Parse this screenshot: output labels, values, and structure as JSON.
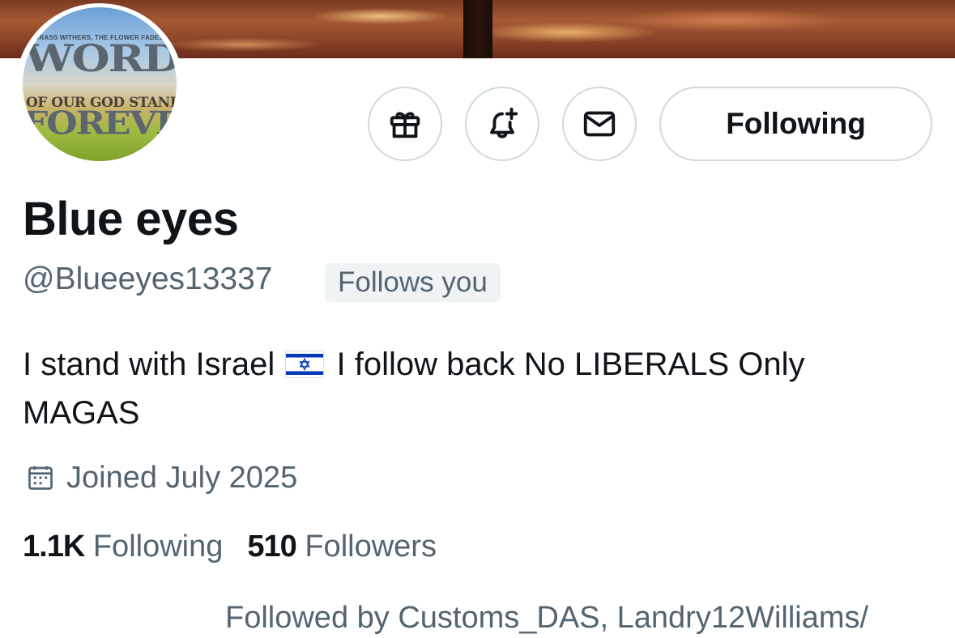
{
  "avatar": {
    "line1": "GRASS WITHERS, THE FLOWER FADES...",
    "line2": "WORD",
    "line3": "OF OUR GOD STAND",
    "line4": "FOREVER"
  },
  "actions": {
    "gift_icon": "gift-icon",
    "notify_icon": "bell-plus-icon",
    "message_icon": "envelope-icon",
    "follow_label": "Following"
  },
  "profile": {
    "display_name": "Blue eyes",
    "handle": "@Blueeyes13337",
    "follows_you": "Follows you",
    "bio_part1": "I stand with Israel",
    "bio_flag": "israel-flag",
    "bio_part2": "I follow back No LIBERALS Only MAGAS",
    "joined": "Joined July 2025"
  },
  "stats": {
    "following_count": "1.1K",
    "following_label": "Following",
    "followers_count": "510",
    "followers_label": "Followers"
  },
  "followed_by": "Followed by Customs_DAS, Landry12Williams/",
  "colors": {
    "text": "#0f1419",
    "secondary": "#536471",
    "border": "#cfd9de",
    "badge_bg": "#eff3f4"
  }
}
